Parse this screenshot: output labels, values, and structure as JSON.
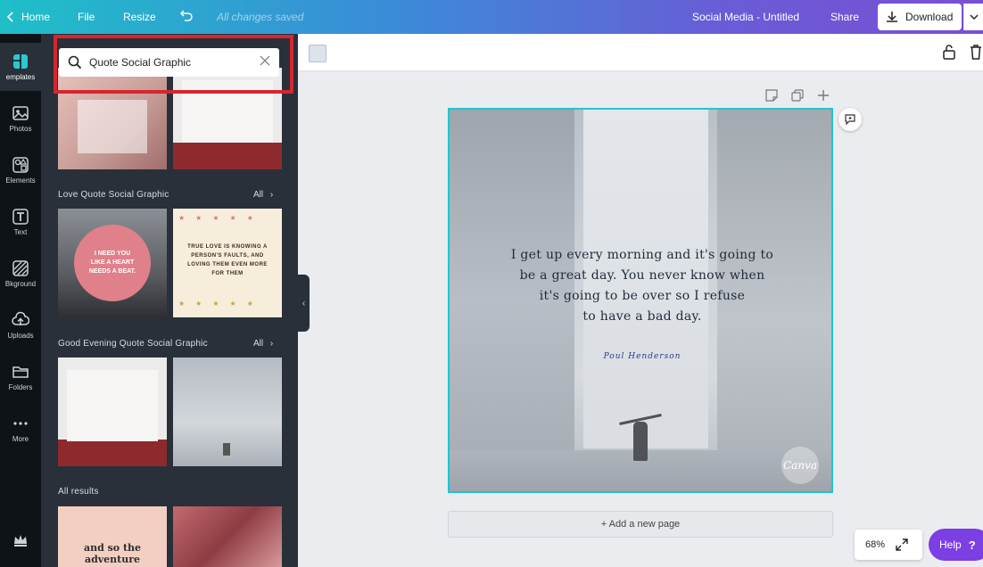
{
  "topbar": {
    "home": "Home",
    "file": "File",
    "resize": "Resize",
    "saved_status": "All changes saved",
    "doc_title": "Social Media - Untitled",
    "share": "Share",
    "download": "Download"
  },
  "rail": {
    "templates": "emplates",
    "photos": "Photos",
    "elements": "Elements",
    "text": "Text",
    "background": "Bkground",
    "uploads": "Uploads",
    "folders": "Folders",
    "more": "More"
  },
  "panel": {
    "search_value": "Quote Social Graphic",
    "section1": "Love Quote Social Graphic",
    "section2": "Good Evening Quote Social Graphic",
    "section3": "All results",
    "all_label": "All",
    "thumb_love_circle": "I NEED YOU LIKE A HEART NEEDS A BEAT.",
    "thumb_true_love": "TRUE LOVE IS KNOWING A PERSON'S FAULTS, AND LOVING THEM EVEN MORE FOR THEM",
    "thumb_adventure": "and so the adventure"
  },
  "canvas": {
    "quote_line1": "I get up every morning and it's going to",
    "quote_line2": "be a great day. You never know when",
    "quote_line3": "it's going to be over so I refuse",
    "quote_line4": "to have a bad day.",
    "author": "Poul Henderson",
    "watermark": "Canva",
    "add_page": "+ Add a new page",
    "zoom": "68%",
    "help": "Help"
  },
  "colors": {
    "accent": "#1ec6d0",
    "help": "#7c3fe4",
    "highlight": "#d6262f",
    "panel": "#293039",
    "rail": "#0e1318"
  }
}
